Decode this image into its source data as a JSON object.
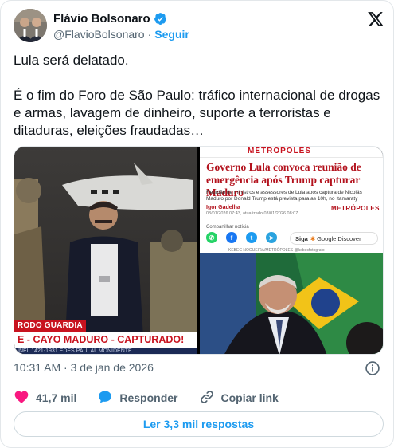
{
  "header": {
    "display_name": "Flávio Bolsonaro",
    "handle": "@FlavioBolsonaro",
    "separator": "·",
    "follow_label": "Seguir",
    "icons": [
      "avatar",
      "verified-badge-icon",
      "x-logo-icon"
    ],
    "colors": {
      "verified": "#1d9bf0",
      "follow": "#1d9bf0"
    }
  },
  "tweet": {
    "line1": "Lula será delatado.",
    "line2": " É o fim do Foro de São Paulo: tráfico internacional de drogas e armas, lavagem de dinheiro, suporte a terroristas e ditaduras, eleições fraudadas…"
  },
  "media": {
    "left": {
      "ticker_top": "RODO GUARDIA",
      "ticker_main": "E - CAYO MADURO - CAPTURADO!",
      "ticker_bottom": "INEL 1421-1931 EDES     PAULAL MONIDENTE"
    },
    "right": {
      "site_name": "METRÓPOLES",
      "headline": "Governo Lula convoca reunião de emergência após Trump capturar Maduro",
      "subtitle": "Reunião de ministros e assessores de Lula após captura de Nicolás Maduro por Donald Trump está prevista para as 10h, no Itamaraty",
      "author": "Igor Gadelha",
      "dates": "03/01/2026 07:43, atualizado 03/01/2026 08:07",
      "brand_logo": "METRÓPOLES",
      "share_label": "Compartilhar notícia",
      "share_icons": [
        "whatsapp-icon",
        "facebook-icon",
        "twitter-icon",
        "telegram-icon"
      ],
      "siga_label": "Siga",
      "discover_label": "Google Discover",
      "photo_credit": "KEBEC NOGUEIRA/METRÓPOLES @kebecfotografo"
    }
  },
  "meta": {
    "timestamp": "10:31 AM · 3 de jan de 2026",
    "icon": "info-icon"
  },
  "actions": {
    "likes": "41,7 mil",
    "reply_label": "Responder",
    "copy_link_label": "Copiar link",
    "colors": {
      "like": "#f91880",
      "reply": "#1d9bf0"
    }
  },
  "footer": {
    "read_replies_label": "Ler 3,3 mil respostas"
  }
}
